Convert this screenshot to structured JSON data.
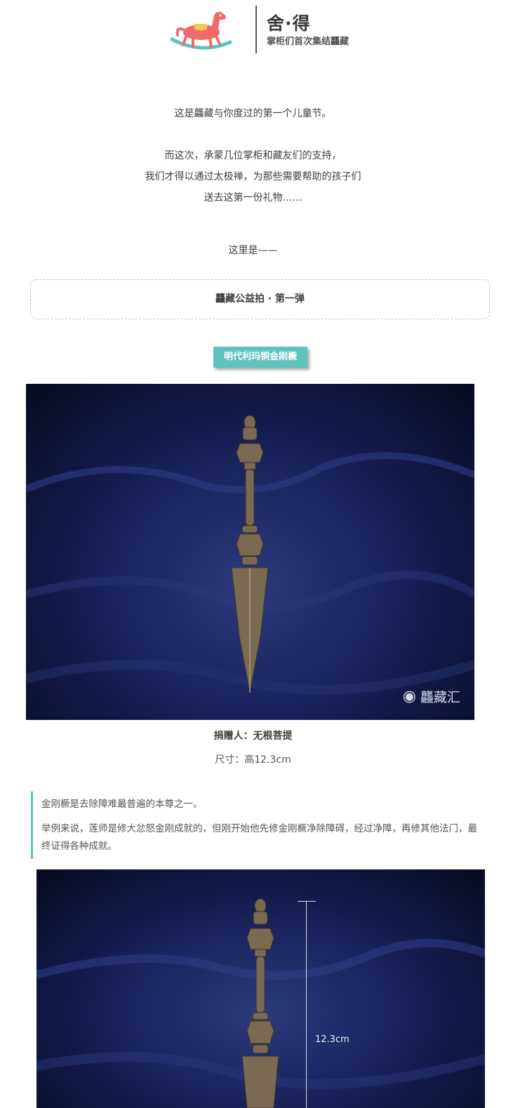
{
  "header": {
    "title": "舍·得",
    "subtitle": "掌柜们首次集结龘藏"
  },
  "intro": {
    "line1": "这是龘藏与你度过的第一个儿童节。",
    "line2": "而这次，承蒙几位掌柜和藏友们的支持，",
    "line3": "我们才得以通过太极禅，为那些需要帮助的孩子们",
    "line4": "送去这第一份礼物……",
    "line5": "这里是——"
  },
  "section_box": {
    "label": "龘藏公益拍 · 第一弹"
  },
  "badge": {
    "label": "明代利玛铜金刚橛"
  },
  "photo1": {
    "watermark": "龘藏汇",
    "watermark_icon": "wechat-icon"
  },
  "donor": {
    "label": "捐赠人：无根菩提"
  },
  "size": {
    "label": "尺寸：高12.3cm"
  },
  "quote": {
    "line1": "金刚橛是去除障难最普遍的本尊之一。",
    "line2": "举例来说，莲师是修大忿怒金刚成就的，但刚开始他先修金刚橛净除障碍，经过净障，再修其他法门，最终证得各种成就。"
  },
  "photo2": {
    "measure_label": "12.3cm"
  },
  "colors": {
    "accent": "#5ec2bd",
    "logo_horse": "#ef6b6b",
    "logo_rocker": "#5ec2bd",
    "logo_saddle": "#f2c94c"
  }
}
